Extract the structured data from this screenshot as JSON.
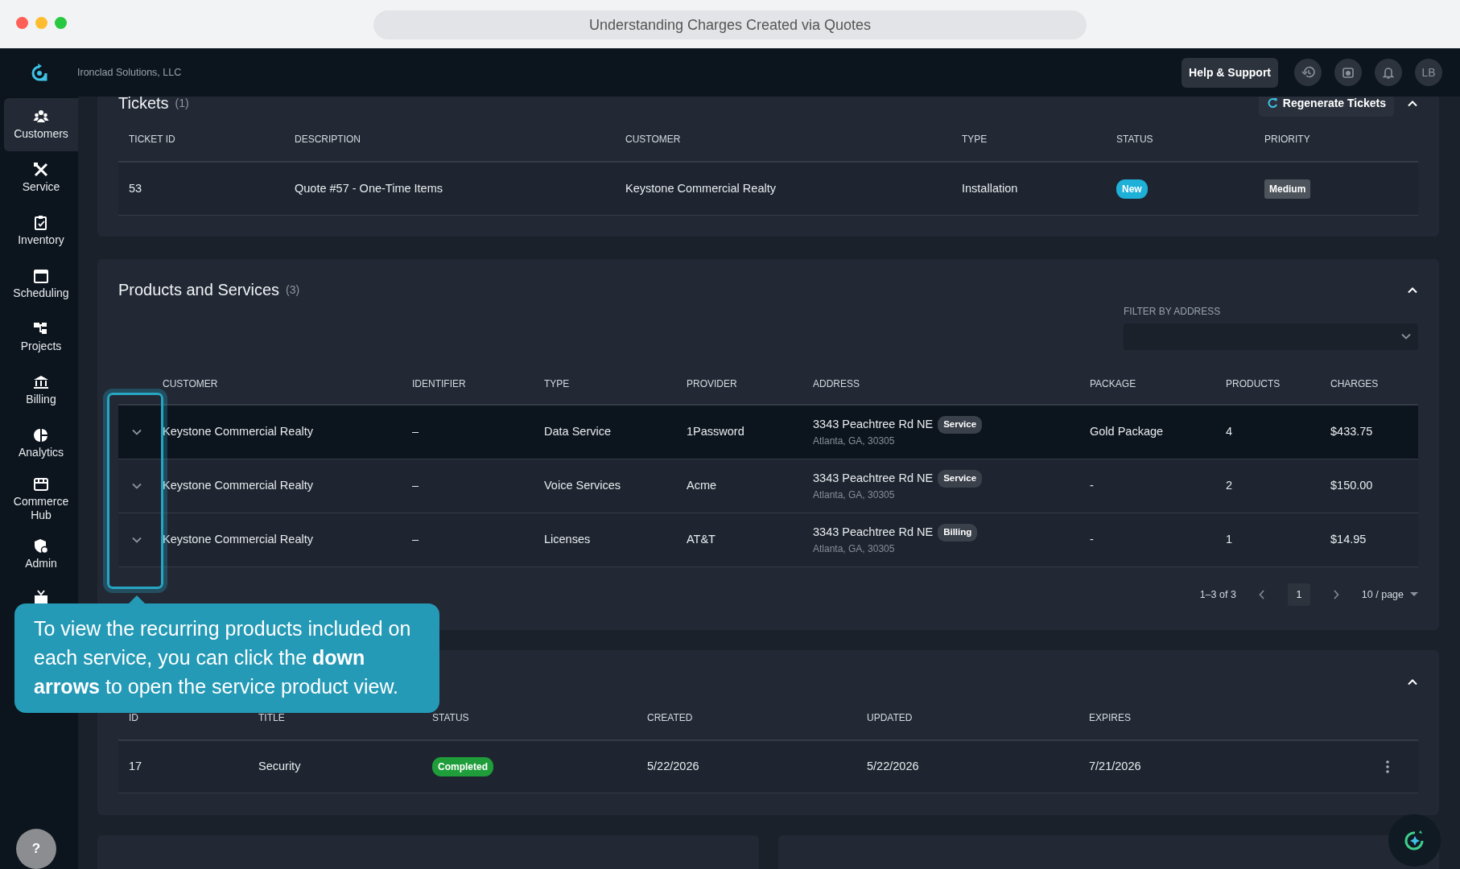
{
  "window": {
    "title": "Understanding Charges Created via Quotes"
  },
  "header": {
    "company": "Ironclad Solutions, LLC",
    "help_button": "Help & Support",
    "avatar": "LB"
  },
  "sidebar": {
    "items": [
      {
        "label": "Customers",
        "selected": true
      },
      {
        "label": "Service",
        "selected": false
      },
      {
        "label": "Inventory",
        "selected": false
      },
      {
        "label": "Scheduling",
        "selected": false
      },
      {
        "label": "Projects",
        "selected": false
      },
      {
        "label": "Billing",
        "selected": false
      },
      {
        "label": "Analytics",
        "selected": false
      },
      {
        "label": "Commerce Hub",
        "selected": false
      },
      {
        "label": "Admin",
        "selected": false
      },
      {
        "selected": false
      }
    ]
  },
  "tickets": {
    "title": "Tickets",
    "count": "(1)",
    "regenerate_button": "Regenerate Tickets",
    "expanded": true,
    "columns": [
      "TICKET ID",
      "DESCRIPTION",
      "CUSTOMER",
      "TYPE",
      "STATUS",
      "PRIORITY"
    ],
    "rows": [
      {
        "ticket_id": "53",
        "description": "Quote #57 - One-Time Items",
        "customer": "Keystone Commercial Realty",
        "type": "Installation",
        "status": {
          "text": "New",
          "color": "#1fb0d8"
        },
        "priority": "Medium"
      }
    ]
  },
  "products": {
    "title": "Products and Services",
    "count": "(3)",
    "expanded": true,
    "filter": {
      "label": "FILTER BY ADDRESS"
    },
    "columns": [
      "CUSTOMER",
      "IDENTIFIER",
      "TYPE",
      "PROVIDER",
      "ADDRESS",
      "PACKAGE",
      "PRODUCTS",
      "CHARGES"
    ],
    "rows": [
      {
        "selected": true,
        "expanded": false,
        "customer": "Keystone Commercial Realty",
        "identifier": "–",
        "type": "Data Service",
        "provider": "1Password",
        "address_line1": "3343 Peachtree Rd NE",
        "address_tag": "Service",
        "address_line2": "Atlanta, GA, 30305",
        "package": "Gold Package",
        "products": "4",
        "charges": "$433.75"
      },
      {
        "selected": false,
        "expanded": false,
        "customer": "Keystone Commercial Realty",
        "identifier": "–",
        "type": "Voice Services",
        "provider": "Acme",
        "address_line1": "3343 Peachtree Rd NE",
        "address_tag": "Service",
        "address_line2": "Atlanta, GA, 30305",
        "package": "-",
        "products": "2",
        "charges": "$150.00"
      },
      {
        "selected": false,
        "expanded": false,
        "customer": "Keystone Commercial Realty",
        "identifier": "–",
        "type": "Licenses",
        "provider": "AT&T",
        "address_line1": "3343 Peachtree Rd NE",
        "address_tag": "Billing",
        "address_line2": "Atlanta, GA, 30305",
        "package": "-",
        "products": "1",
        "charges": "$14.95"
      }
    ],
    "pagination": {
      "range": "1–3 of 3",
      "pages": [
        {
          "label": "1",
          "selected": true
        }
      ],
      "page_size": "10 / page"
    }
  },
  "quotes": {
    "expanded": true,
    "columns": [
      "ID",
      "TITLE",
      "STATUS",
      "CREATED",
      "UPDATED",
      "EXPIRES"
    ],
    "rows": [
      {
        "id": "17",
        "title": "Security",
        "status": {
          "text": "Completed",
          "color": "#1f9d3a"
        },
        "created": "5/22/2026",
        "updated": "5/22/2026",
        "expires": "7/21/2026"
      }
    ]
  },
  "help_button": {
    "label": "?"
  },
  "tooltip": {
    "text": "To view the recurring products included on each service, you can click the **down arrows** to open the service product view."
  }
}
